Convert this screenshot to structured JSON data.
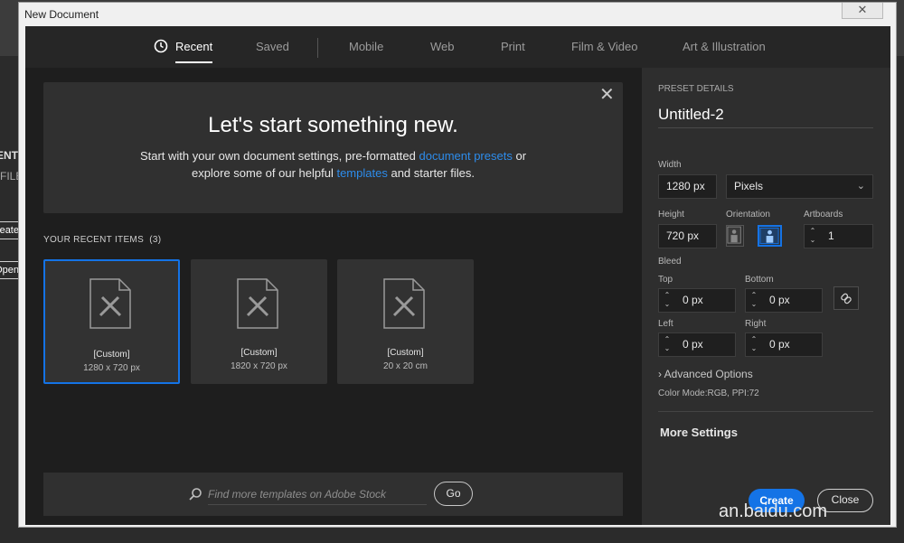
{
  "window": {
    "title": "New Document",
    "close_glyph": "✕"
  },
  "background": {
    "recent_label": "RECENT",
    "files_label": "FILE",
    "create_label": "Create...",
    "open_label": "Open..."
  },
  "tabs": [
    {
      "label": "Recent",
      "active": true
    },
    {
      "label": "Saved"
    },
    {
      "label": "Mobile"
    },
    {
      "label": "Web"
    },
    {
      "label": "Print"
    },
    {
      "label": "Film & Video"
    },
    {
      "label": "Art & Illustration"
    }
  ],
  "hero": {
    "title": "Let's start something new.",
    "line1_pre": "Start with your own document settings, pre-formatted",
    "line1_link": "document presets",
    "line1_post": "or",
    "line2_pre": "explore some of our helpful",
    "line2_link": "templates",
    "line2_post": "and starter files.",
    "close_glyph": "✕"
  },
  "recent": {
    "label": "YOUR RECENT ITEMS",
    "count": "(3)",
    "items": [
      {
        "name": "[Custom]",
        "size": "1280 x 720 px",
        "selected": true
      },
      {
        "name": "[Custom]",
        "size": "1820 x 720 px"
      },
      {
        "name": "[Custom]",
        "size": "20 x 20 cm"
      }
    ]
  },
  "stock": {
    "placeholder": "Find more templates on Adobe Stock",
    "go_label": "Go",
    "icon": "search-icon"
  },
  "preset": {
    "heading": "PRESET DETAILS",
    "doc_name": "Untitled-2",
    "width_label": "Width",
    "width_value": "1280 px",
    "units_label": "Pixels",
    "height_label": "Height",
    "height_value": "720 px",
    "orientation_label": "Orientation",
    "artboards_label": "Artboards",
    "artboards_value": "1",
    "bleed_label": "Bleed",
    "top_label": "Top",
    "top_value": "0 px",
    "bottom_label": "Bottom",
    "bottom_value": "0 px",
    "left_label": "Left",
    "left_value": "0 px",
    "right_label": "Right",
    "right_value": "0 px",
    "advanced_label": "Advanced Options",
    "color_mode": "Color Mode:RGB, PPI:72",
    "more_settings": "More Settings",
    "create_label": "Create",
    "close_label": "Close"
  },
  "watermark": "an.baidu.com",
  "colors": {
    "accent": "#1473e6",
    "link": "#2d8ceb",
    "panel": "#2e2e2e",
    "bg": "#1e1e1e"
  }
}
